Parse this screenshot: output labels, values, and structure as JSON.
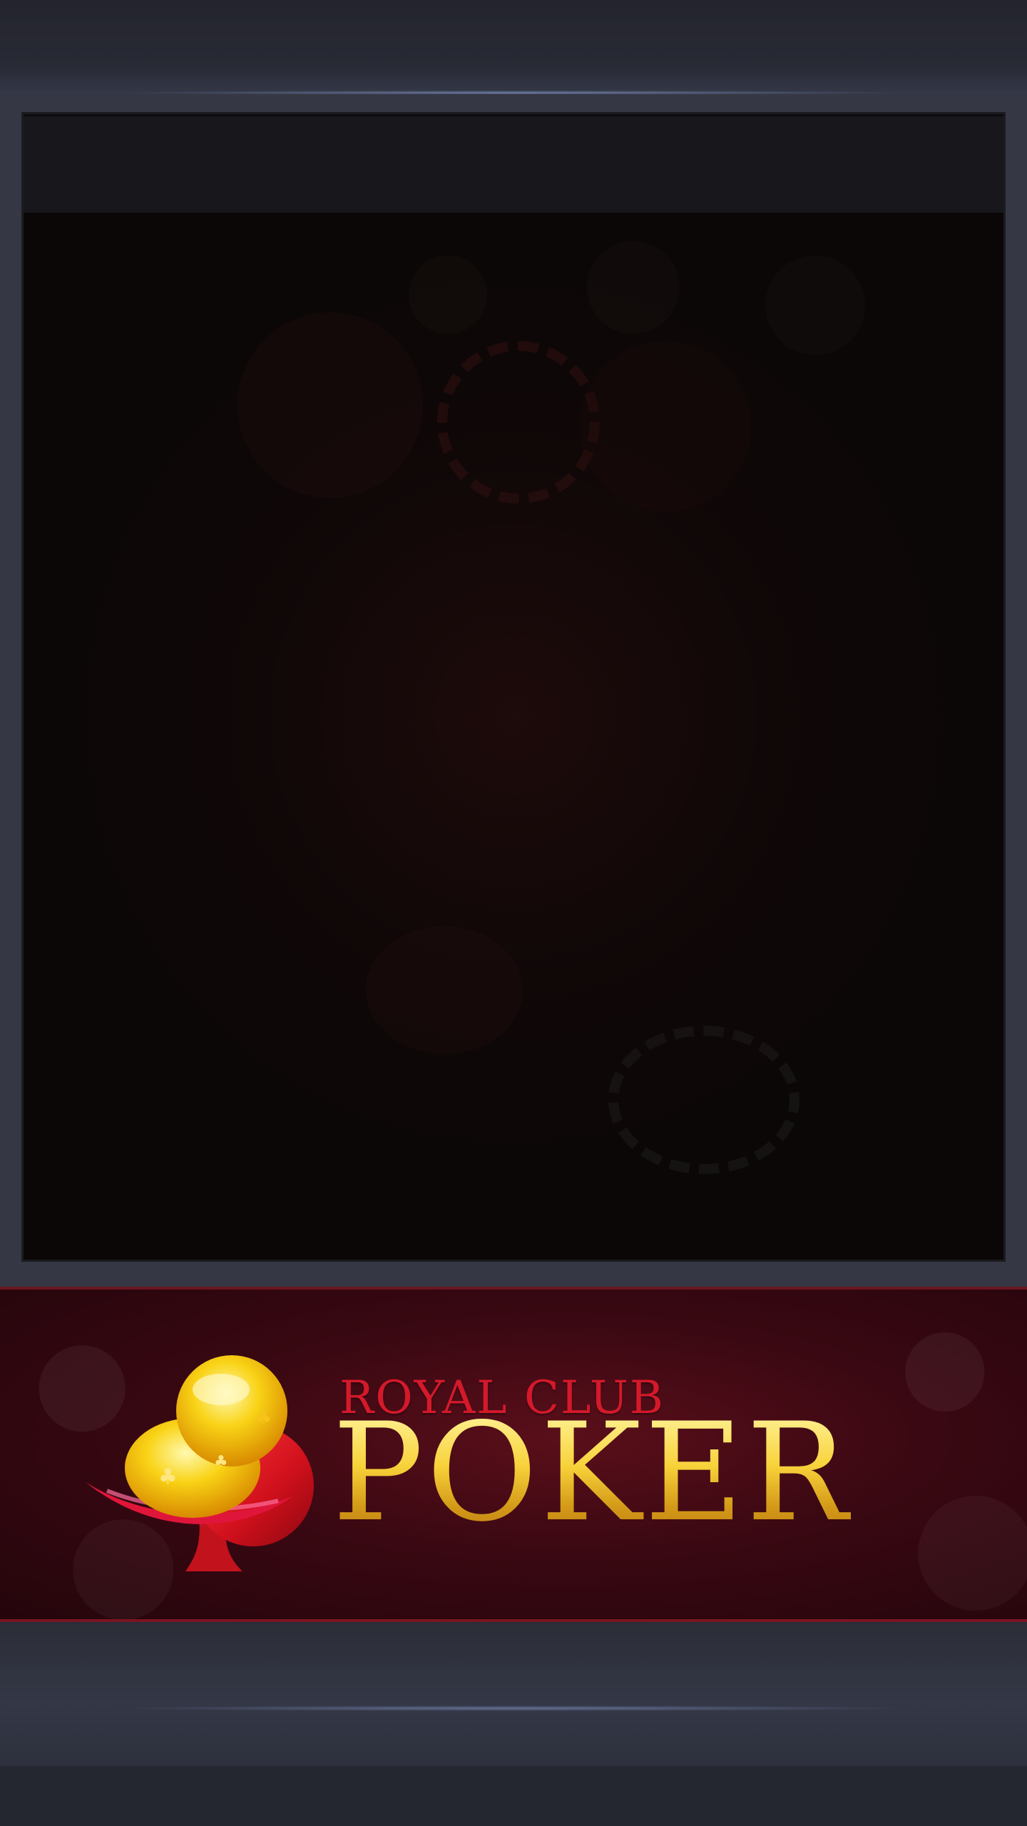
{
  "banner": {
    "brand_sub": "ROYAL CLUB",
    "brand_main": "POKER"
  },
  "icons": {
    "logo": "club-suit-icon"
  },
  "colors": {
    "background": "#25262f",
    "panel": "#0a0707",
    "banner_red": "#3a0812",
    "brand_red": "#d4192a",
    "brand_gold": "#f8d23a"
  }
}
